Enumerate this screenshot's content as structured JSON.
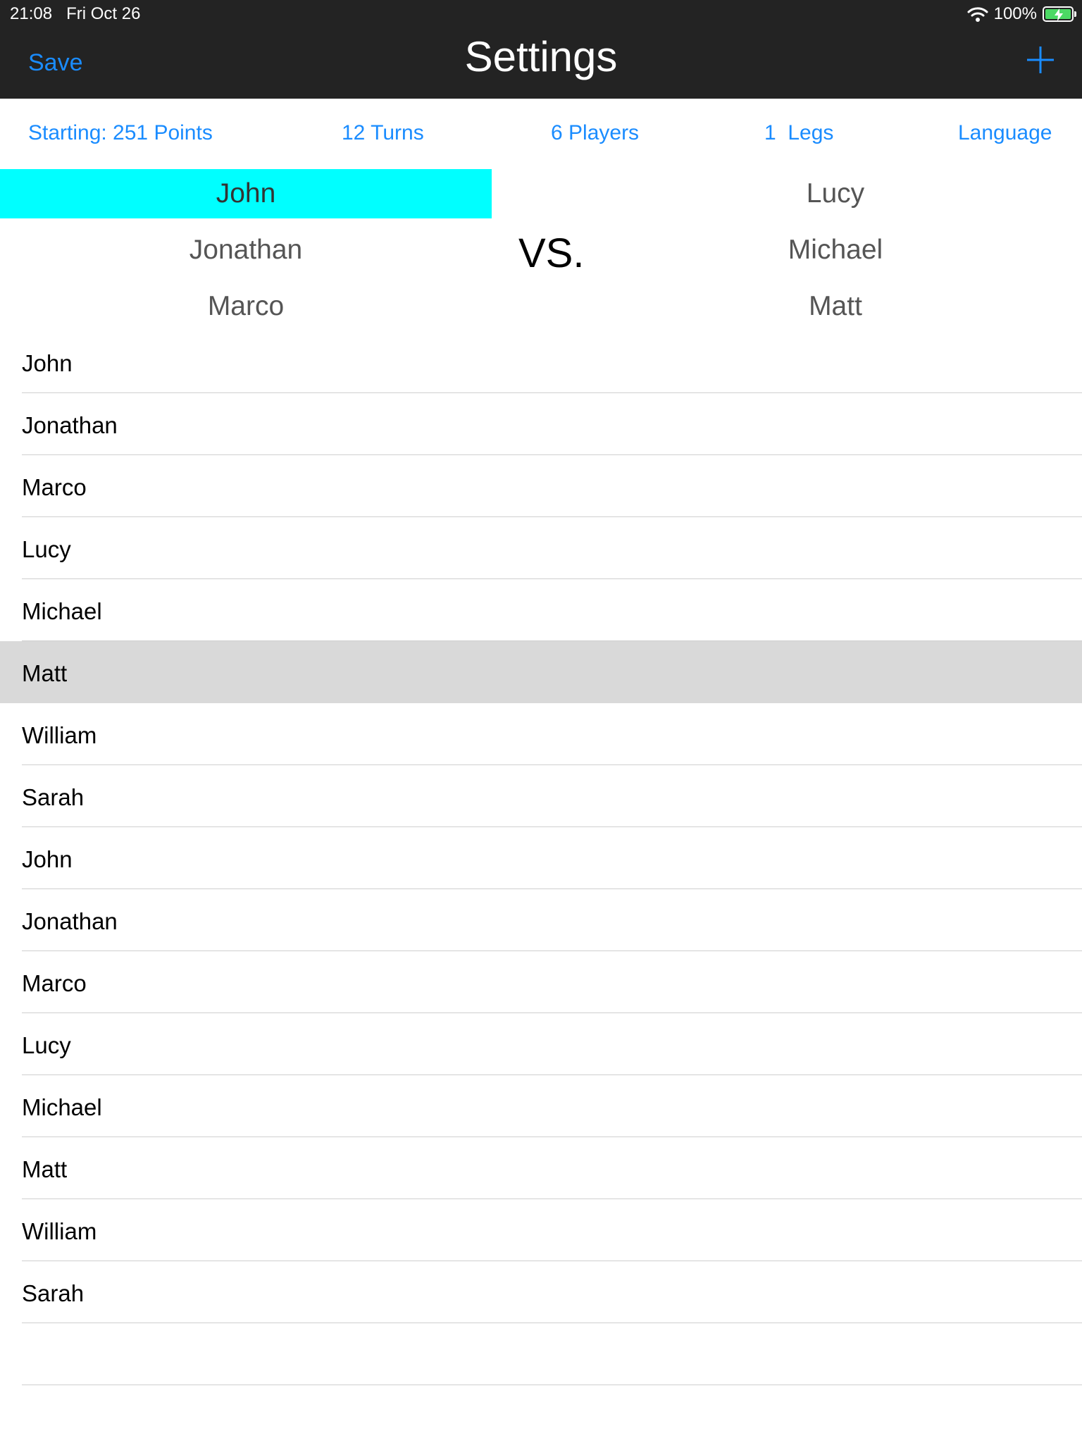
{
  "status_bar": {
    "time": "21:08",
    "date": "Fri Oct 26",
    "battery_percent": "100%"
  },
  "nav": {
    "save_label": "Save",
    "title": "Settings",
    "add_icon": "plus-icon"
  },
  "options": {
    "starting": "Starting: 251 Points",
    "turns": "12 Turns",
    "players": "6 Players",
    "legs": "1  Legs",
    "language": "Language"
  },
  "teams": {
    "left": [
      "John",
      "Jonathan",
      "Marco"
    ],
    "right": [
      "Lucy",
      "Michael",
      "Matt"
    ],
    "vs_label": "VS."
  },
  "players": [
    "John",
    "Jonathan",
    "Marco",
    "Lucy",
    "Michael",
    "Matt",
    "William",
    "Sarah",
    "John",
    "Jonathan",
    "Marco",
    "Lucy",
    "Michael",
    "Matt",
    "William",
    "Sarah"
  ],
  "colors": {
    "nav_background": "#232323",
    "accent": "#1a8cff",
    "current_player_highlight": "#00ffff",
    "selected_row": "#d9d9d9",
    "battery": "#4cd964"
  }
}
